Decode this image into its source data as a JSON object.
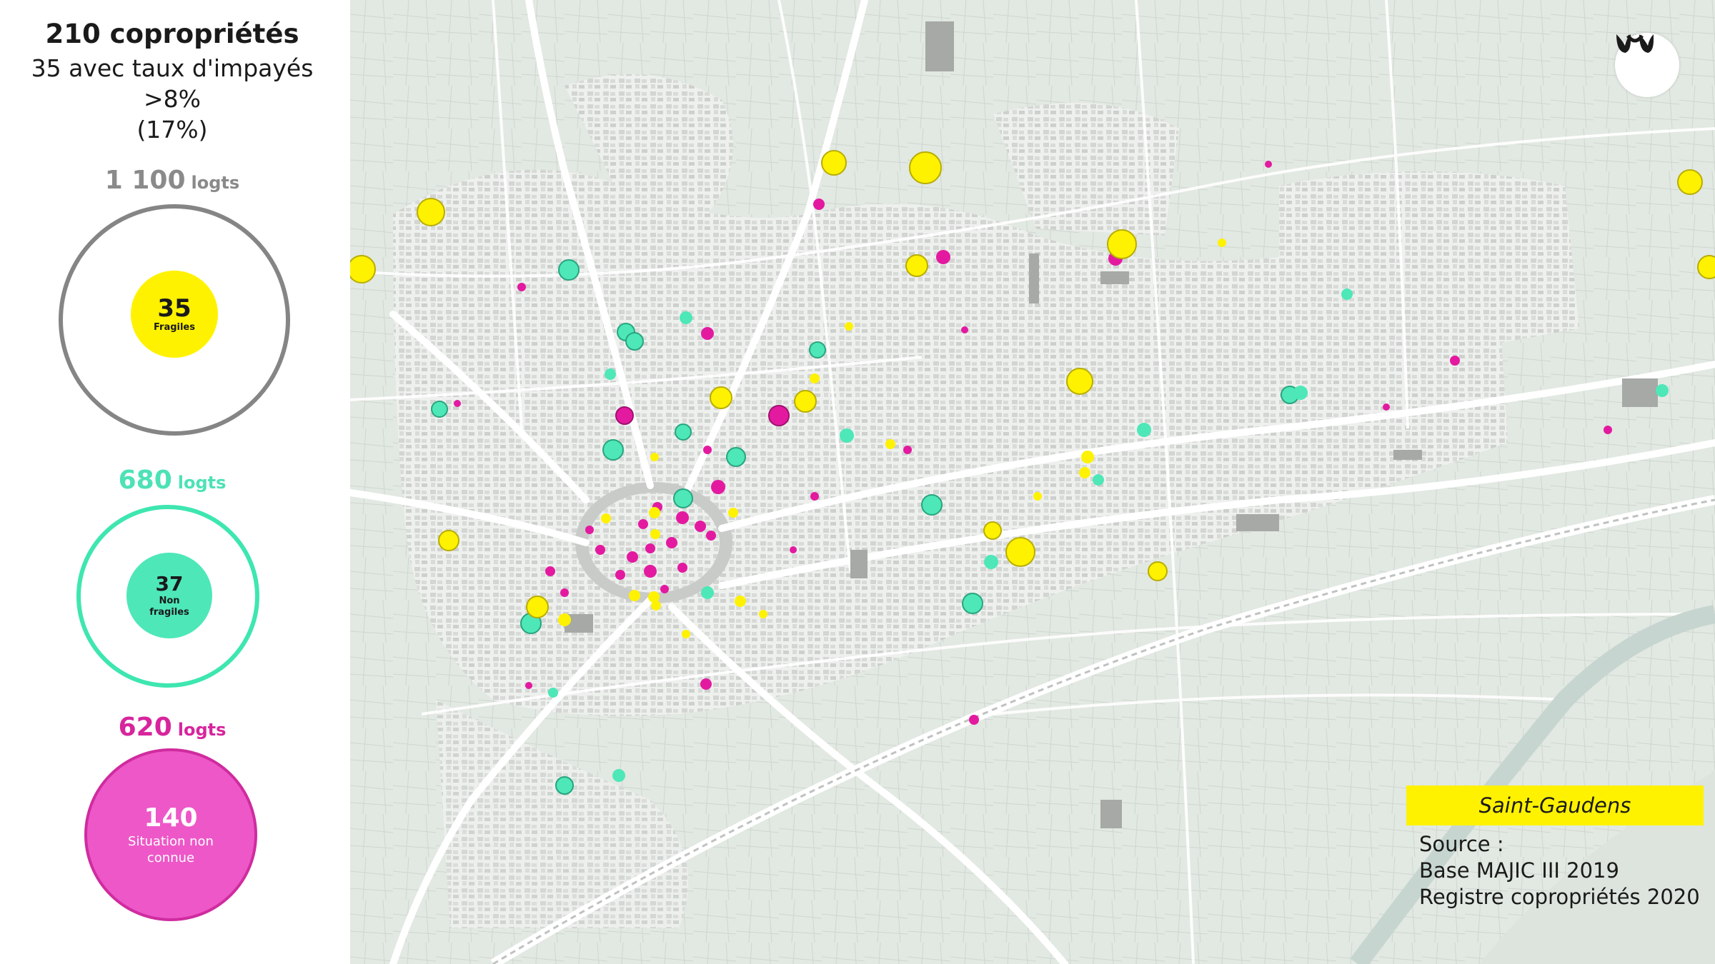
{
  "summary": {
    "title": "210 copropriétés",
    "subtitle": "35 avec taux d'impayés",
    "threshold": ">8%",
    "percentage": "(17%)"
  },
  "categories": [
    {
      "id": "fragiles",
      "logements": "1 100",
      "unit": "logts",
      "count": "35",
      "label": "Fragiles",
      "color": "#fff200",
      "ring_color": "#858585"
    },
    {
      "id": "non-fragiles",
      "logements": "680",
      "unit": "logts",
      "count": "37",
      "label": "Non fragiles",
      "color": "#4ee7b8",
      "ring_color": "#3ee6b0"
    },
    {
      "id": "inconnue",
      "logements": "620",
      "unit": "logts",
      "count": "140",
      "label": "Situation non connue",
      "color": "#ee57c8",
      "ring_color": "#cf2c9f"
    }
  ],
  "map": {
    "city": "Saint-Gaudens",
    "source_title": "Source :",
    "sources": [
      "Base MAJIC III 2019",
      "Registre copropriétés 2020"
    ],
    "logo_icon": "brand-logo-icon"
  }
}
